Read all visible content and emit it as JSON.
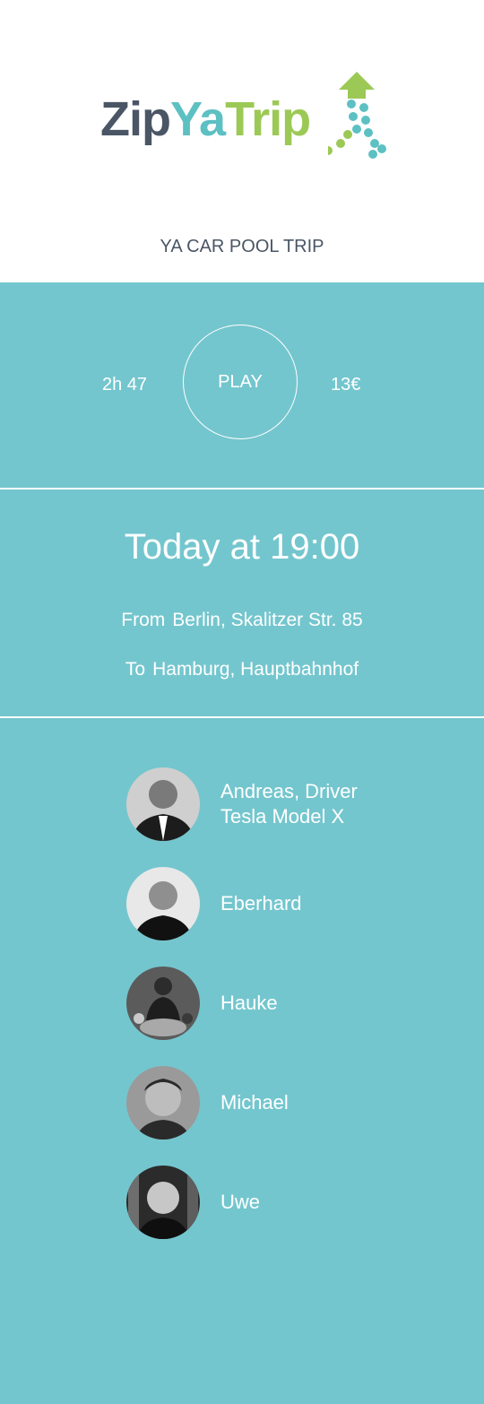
{
  "brand": {
    "part1": "Zip",
    "part2": "Ya",
    "part3": "Trip",
    "colors": {
      "zip": "#4a5665",
      "ya": "#5dc0c3",
      "trip": "#9cc955"
    }
  },
  "subtitle": "YA CAR POOL TRIP",
  "player": {
    "duration": "2h 47",
    "play_label": "PLAY",
    "price": "13€"
  },
  "trip": {
    "time": "Today at 19:00",
    "from_label": "From",
    "from": "Berlin, Skalitzer Str. 85",
    "to_label": "To",
    "to": "Hamburg, Hauptbahnhof"
  },
  "passengers": [
    {
      "name": "Andreas, Driver",
      "detail": "Tesla Model X"
    },
    {
      "name": "Eberhard"
    },
    {
      "name": "Hauke"
    },
    {
      "name": "Michael"
    },
    {
      "name": "Uwe"
    }
  ],
  "colors": {
    "accent": "#74c6ce",
    "text_dark": "#4a5665"
  }
}
